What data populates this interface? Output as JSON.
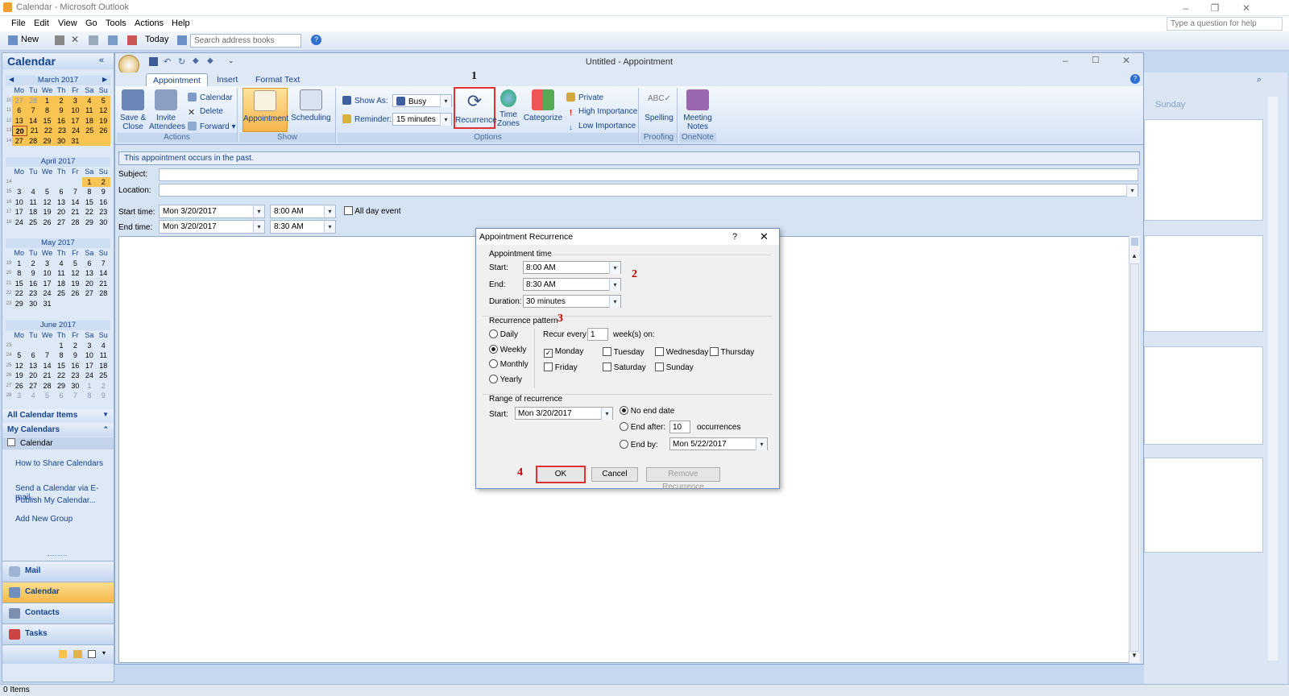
{
  "window": {
    "title": "Calendar - Microsoft Outlook",
    "help_placeholder": "Type a question for help"
  },
  "menu": [
    "File",
    "Edit",
    "View",
    "Go",
    "Tools",
    "Actions",
    "Help"
  ],
  "toolbar": {
    "new": "New",
    "today": "Today",
    "search_placeholder": "Search address books"
  },
  "nav": {
    "title": "Calendar",
    "months": [
      {
        "name": "March 2017",
        "weeks": [
          {
            "wk": "10",
            "days": [
              "27",
              "28",
              "1",
              "2",
              "3",
              "4",
              "5"
            ]
          },
          {
            "wk": "11",
            "days": [
              "6",
              "7",
              "8",
              "9",
              "10",
              "11",
              "12"
            ]
          },
          {
            "wk": "12",
            "days": [
              "13",
              "14",
              "15",
              "16",
              "17",
              "18",
              "19"
            ]
          },
          {
            "wk": "13",
            "days": [
              "20",
              "21",
              "22",
              "23",
              "24",
              "25",
              "26"
            ]
          },
          {
            "wk": "14",
            "days": [
              "27",
              "28",
              "29",
              "30",
              "31",
              "",
              ""
            ]
          }
        ]
      },
      {
        "name": "April 2017",
        "weeks": [
          {
            "wk": "14",
            "days": [
              "",
              "",
              "",
              "",
              "",
              "1",
              "2"
            ]
          },
          {
            "wk": "15",
            "days": [
              "3",
              "4",
              "5",
              "6",
              "7",
              "8",
              "9"
            ]
          },
          {
            "wk": "16",
            "days": [
              "10",
              "11",
              "12",
              "13",
              "14",
              "15",
              "16"
            ]
          },
          {
            "wk": "17",
            "days": [
              "17",
              "18",
              "19",
              "20",
              "21",
              "22",
              "23"
            ]
          },
          {
            "wk": "18",
            "days": [
              "24",
              "25",
              "26",
              "27",
              "28",
              "29",
              "30"
            ]
          }
        ]
      },
      {
        "name": "May 2017",
        "weeks": [
          {
            "wk": "19",
            "days": [
              "1",
              "2",
              "3",
              "4",
              "5",
              "6",
              "7"
            ]
          },
          {
            "wk": "20",
            "days": [
              "8",
              "9",
              "10",
              "11",
              "12",
              "13",
              "14"
            ]
          },
          {
            "wk": "21",
            "days": [
              "15",
              "16",
              "17",
              "18",
              "19",
              "20",
              "21"
            ]
          },
          {
            "wk": "22",
            "days": [
              "22",
              "23",
              "24",
              "25",
              "26",
              "27",
              "28"
            ]
          },
          {
            "wk": "23",
            "days": [
              "29",
              "30",
              "31",
              "",
              "",
              "",
              ""
            ]
          }
        ]
      },
      {
        "name": "June 2017",
        "weeks": [
          {
            "wk": "23",
            "days": [
              "",
              "",
              "",
              "1",
              "2",
              "3",
              "4"
            ]
          },
          {
            "wk": "24",
            "days": [
              "5",
              "6",
              "7",
              "8",
              "9",
              "10",
              "11"
            ]
          },
          {
            "wk": "25",
            "days": [
              "12",
              "13",
              "14",
              "15",
              "16",
              "17",
              "18"
            ]
          },
          {
            "wk": "26",
            "days": [
              "19",
              "20",
              "21",
              "22",
              "23",
              "24",
              "25"
            ]
          },
          {
            "wk": "27",
            "days": [
              "26",
              "27",
              "28",
              "29",
              "30",
              "1",
              "2"
            ]
          },
          {
            "wk": "28",
            "days": [
              "3",
              "4",
              "5",
              "6",
              "7",
              "8",
              "9"
            ]
          }
        ]
      }
    ],
    "weekday_heads": [
      "Mo",
      "Tu",
      "We",
      "Th",
      "Fr",
      "Sa",
      "Su"
    ],
    "all_items": "All Calendar Items",
    "my_calendars": "My Calendars",
    "calendar_item": "Calendar",
    "links": [
      "How to Share Calendars",
      "Send a Calendar via E-mail...",
      "Publish My Calendar...",
      "Add New Group"
    ],
    "buttons": [
      "Mail",
      "Calendar",
      "Contacts",
      "Tasks"
    ]
  },
  "appointment": {
    "title": "Untitled - Appointment",
    "tabs": [
      "Appointment",
      "Insert",
      "Format Text"
    ],
    "ribbon": {
      "save_close": "Save & Close",
      "invite": "Invite Attendees",
      "calendar": "Calendar",
      "delete": "Delete",
      "forward": "Forward",
      "actions": "Actions",
      "appointment": "Appointment",
      "scheduling": "Scheduling",
      "show": "Show",
      "show_as_label": "Show As:",
      "show_as": "Busy",
      "reminder_label": "Reminder:",
      "reminder": "15 minutes",
      "recurrence": "Recurrence",
      "time_zones": "Time Zones",
      "categorize": "Categorize",
      "private": "Private",
      "high": "High Importance",
      "low": "Low Importance",
      "options": "Options",
      "spelling": "Spelling",
      "proofing": "Proofing",
      "meeting_notes": "Meeting Notes",
      "onenote": "OneNote"
    },
    "info": "This appointment occurs in the past.",
    "subject_label": "Subject:",
    "location_label": "Location:",
    "start_label": "Start time:",
    "end_label": "End time:",
    "start_date": "Mon 3/20/2017",
    "start_time": "8:00 AM",
    "end_date": "Mon 3/20/2017",
    "end_time": "8:30 AM",
    "all_day": "All day event"
  },
  "right": {
    "sunday": "Sunday"
  },
  "dialog": {
    "title": "Appointment Recurrence",
    "appt_time": "Appointment time",
    "start_label": "Start:",
    "start": "8:00 AM",
    "end_label": "End:",
    "end": "8:30 AM",
    "duration_label": "Duration:",
    "duration": "30 minutes",
    "pattern": "Recurrence pattern",
    "daily": "Daily",
    "weekly": "Weekly",
    "monthly": "Monthly",
    "yearly": "Yearly",
    "recur_every": "Recur every",
    "recur_value": "1",
    "weeks_on": "week(s) on:",
    "days": [
      "Monday",
      "Tuesday",
      "Wednesday",
      "Thursday",
      "Friday",
      "Saturday",
      "Sunday"
    ],
    "range": "Range of recurrence",
    "range_start_label": "Start:",
    "range_start": "Mon 3/20/2017",
    "no_end": "No end date",
    "end_after": "End after:",
    "end_after_value": "10",
    "occurrences": "occurrences",
    "end_by": "End by:",
    "end_by_value": "Mon 5/22/2017",
    "ok": "OK",
    "cancel": "Cancel",
    "remove": "Remove Recurrence"
  },
  "annotations": {
    "m1": "1",
    "m2": "2",
    "m3": "3",
    "m4": "4"
  },
  "status": "0 Items"
}
